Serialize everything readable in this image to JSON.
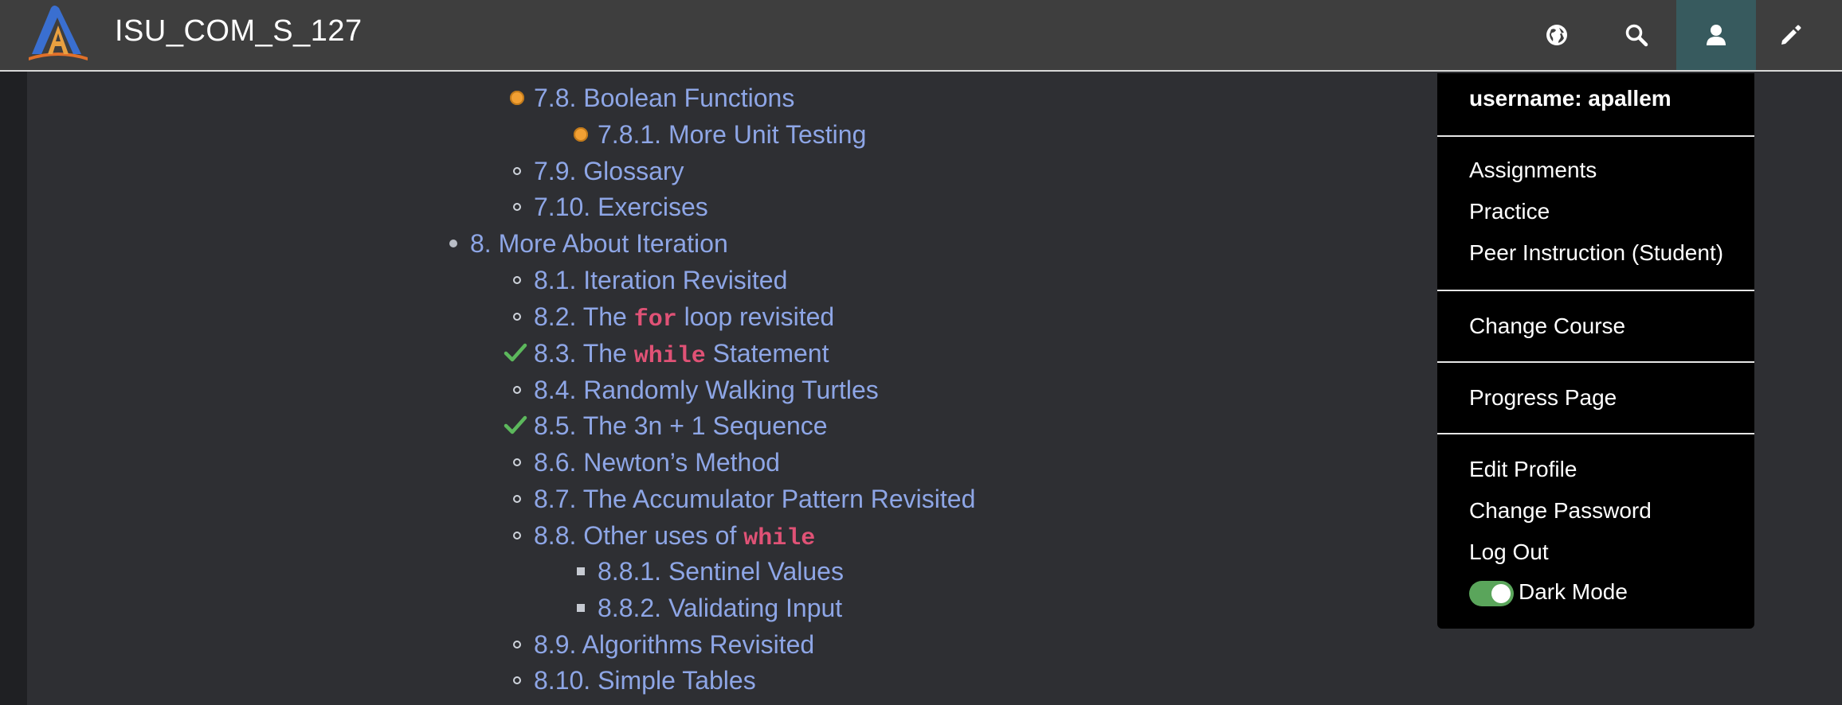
{
  "topbar": {
    "brand": "ISU_COM_S_127",
    "icons": [
      "logo-icon",
      "globe-icon",
      "search-icon",
      "user-icon",
      "pencil-icon"
    ],
    "colors": {
      "bar": "#3e3e3e",
      "user_active": "#375a5e"
    }
  },
  "toc": {
    "items": [
      {
        "num": "7.8.",
        "label": "Boolean Functions",
        "marker": "orange-dot"
      },
      {
        "num": "7.8.1.",
        "label": "More Unit Testing",
        "marker": "orange-dot"
      },
      {
        "num": "7.9.",
        "label": "Glossary",
        "marker": "circle"
      },
      {
        "num": "7.10.",
        "label": "Exercises",
        "marker": "circle"
      },
      {
        "num": "8.",
        "label": "More About Iteration",
        "marker": "disc"
      },
      {
        "num": "8.1.",
        "label": "Iteration Revisited",
        "marker": "circle"
      },
      {
        "num": "8.2.",
        "label_before": "The",
        "code": "for",
        "label_after": "loop revisited",
        "marker": "circle"
      },
      {
        "num": "8.3.",
        "label_before": "The",
        "code": "while",
        "label_after": "Statement",
        "marker": "check"
      },
      {
        "num": "8.4.",
        "label": "Randomly Walking Turtles",
        "marker": "circle"
      },
      {
        "num": "8.5.",
        "label": "The 3n + 1 Sequence",
        "marker": "check"
      },
      {
        "num": "8.6.",
        "label": "Newton’s Method",
        "marker": "circle"
      },
      {
        "num": "8.7.",
        "label": "The Accumulator Pattern Revisited",
        "marker": "circle"
      },
      {
        "num": "8.8.",
        "label_before": "Other uses of",
        "code": "while",
        "marker": "circle"
      },
      {
        "num": "8.8.1.",
        "label": "Sentinel Values",
        "marker": "square"
      },
      {
        "num": "8.8.2.",
        "label": "Validating Input",
        "marker": "square"
      },
      {
        "num": "8.9.",
        "label": "Algorithms Revisited",
        "marker": "circle"
      },
      {
        "num": "8.10.",
        "label": "Simple Tables",
        "marker": "circle"
      }
    ],
    "colors": {
      "link": "#8ea6e6",
      "code": "#e05276",
      "check": "#5cb85c",
      "orange": "#f2a033"
    }
  },
  "dropdown": {
    "username": "username: apallem",
    "items": {
      "assignments": "Assignments",
      "practice": "Practice",
      "peer": "Peer Instruction (Student)",
      "change_course": "Change Course",
      "progress": "Progress Page",
      "edit_profile": "Edit Profile",
      "change_password": "Change Password",
      "log_out": "Log Out"
    },
    "dark_mode": {
      "label": "Dark Mode",
      "enabled": true
    }
  }
}
